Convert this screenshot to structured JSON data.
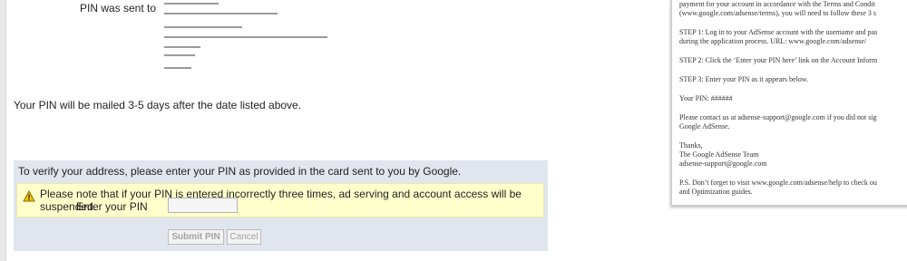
{
  "address": {
    "label": "PIN was sent to"
  },
  "mail_note": "Your PIN will be mailed 3-5 days after the date listed above.",
  "verify": {
    "instruction": "To verify your address, please enter your PIN as provided in the card sent to you by Google.",
    "warning": "Please note that if your PIN is entered incorrectly three times, ad serving and account access will be suspended.",
    "pin_label": "Enter your PIN",
    "pin_value": "",
    "submit_label": "Submit PIN",
    "cancel_label": "Cancel"
  },
  "letter": {
    "intro_1": "payment for your account in accordance with the Terms and Condit",
    "intro_2": "(www.google.com/adsense/terms), you will need to follow these 3 s",
    "step1_1": "STEP 1: Log in to your AdSense account with the username and pas",
    "step1_2": "during the application process.  URL: www.google.com/adsense/",
    "step2": "STEP 2: Click the ‘Enter your PIN here’ link on the Account Inform",
    "step3": "STEP 3: Enter your PIN as it appears below.",
    "pin_line": "Your PIN: ######",
    "contact_1": "Please contact us at adsense-support@google.com if you did not sig",
    "contact_2": "Google AdSense.",
    "thanks": "Thanks,",
    "team": "The Google AdSense Team",
    "email": "adsense-support@google.com",
    "ps_1": "P.S. Don’t forget to visit www.google.com/adsense/help to check ou",
    "ps_2": "and Optimization guides."
  }
}
